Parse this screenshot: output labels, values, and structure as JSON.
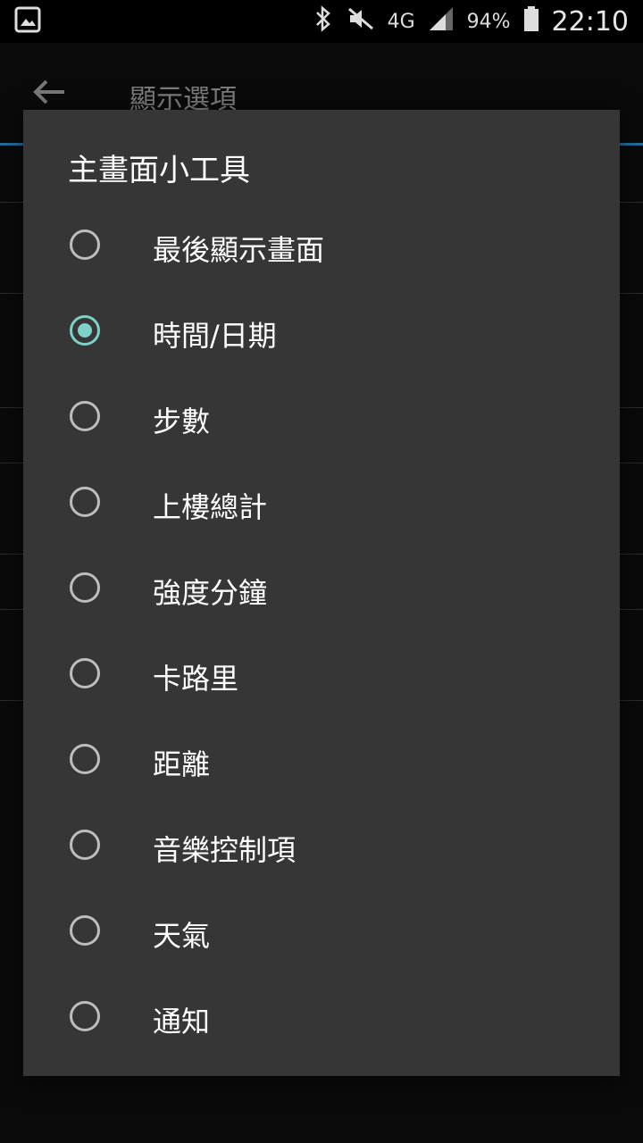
{
  "status_bar": {
    "network": "4G",
    "battery": "94%",
    "time": "22:10",
    "icons": [
      "gallery-icon",
      "bluetooth-icon",
      "mute-icon",
      "signal-icon",
      "battery-icon"
    ]
  },
  "app": {
    "title": "顯示選項"
  },
  "dialog": {
    "title": "主畫面小工具",
    "selected_index": 1,
    "options": [
      {
        "label": "最後顯示畫面",
        "checked": false
      },
      {
        "label": "時間/日期",
        "checked": true
      },
      {
        "label": "步數",
        "checked": false
      },
      {
        "label": "上樓總計",
        "checked": false
      },
      {
        "label": "強度分鐘",
        "checked": false
      },
      {
        "label": "卡路里",
        "checked": false
      },
      {
        "label": "距離",
        "checked": false
      },
      {
        "label": "音樂控制項",
        "checked": false
      },
      {
        "label": "天氣",
        "checked": false
      },
      {
        "label": "通知",
        "checked": false
      }
    ]
  },
  "colors": {
    "accent": "#7fd0c8",
    "dialog_bg": "#363636",
    "appbar_underline": "#1c6fa5"
  }
}
